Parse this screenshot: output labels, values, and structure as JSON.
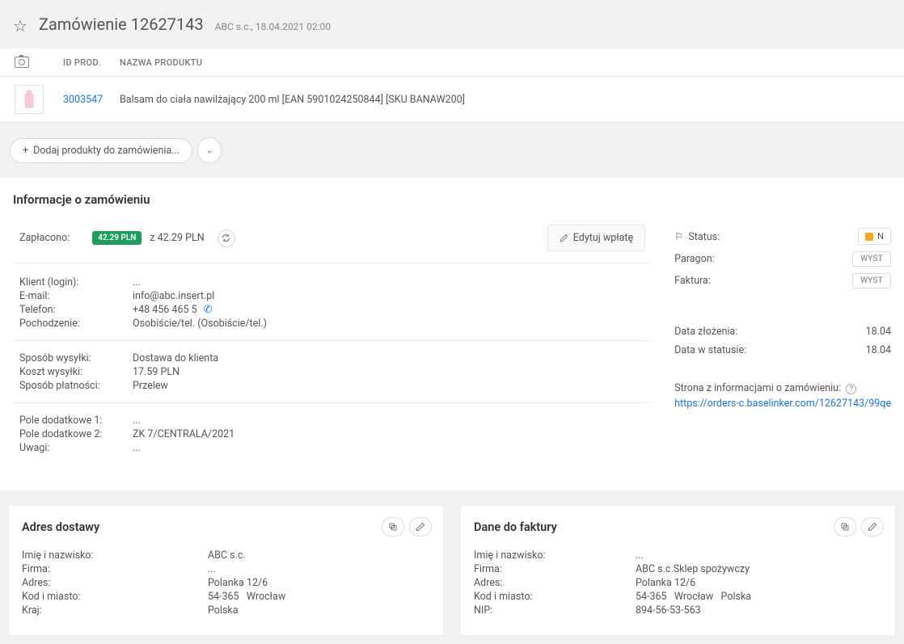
{
  "header": {
    "title": "Zamówienie 12627143",
    "subtitle": "ABC s.c., 18.04.2021 02:00"
  },
  "product_table": {
    "headers": {
      "id": "ID PROD.",
      "name": "NAZWA PRODUKTU"
    },
    "row": {
      "id": "3003547",
      "name": "Balsam do ciała nawilżający 200 ml [EAN 5901024250844] [SKU BANAW200]"
    }
  },
  "actions": {
    "add_products": "Dodaj produkty do zamówienia..."
  },
  "order_info": {
    "title": "Informacje o zamówieniu",
    "paid_label": "Zapłacono:",
    "paid_badge": "42.29 PLN",
    "paid_total": "z 42.29 PLN",
    "edit_payment": "Edytuj wpłatę",
    "client_login_label": "Klient (login):",
    "client_login_value": "...",
    "email_label": "E-mail:",
    "email_value": "info@abc.insert.pl",
    "phone_label": "Telefon:",
    "phone_value": "+48 456 465 5",
    "origin_label": "Pochodzenie:",
    "origin_value": "Osobiście/tel. (Osobiście/tel.)",
    "shipping_method_label": "Sposób wysyłki:",
    "shipping_method_value": "Dostawa do klienta",
    "shipping_cost_label": "Koszt wysyłki:",
    "shipping_cost_value": "17.59 PLN",
    "payment_method_label": "Sposób płatności:",
    "payment_method_value": "Przelew",
    "extra1_label": "Pole dodatkowe 1:",
    "extra1_value": "...",
    "extra2_label": "Pole dodatkowe 2:",
    "extra2_value": "ZK 7/CENTRALA/2021",
    "notes_label": "Uwagi:",
    "notes_value": "..."
  },
  "right_panel": {
    "status_label": "Status:",
    "status_value": "N",
    "receipt_label": "Paragon:",
    "receipt_btn": "WYST",
    "invoice_label": "Faktura:",
    "invoice_btn": "WYST",
    "date_created_label": "Data złożenia:",
    "date_created_value": "18.04",
    "date_status_label": "Data w statusie:",
    "date_status_value": "18.04",
    "info_page_label": "Strona z informacjami o zamówieniu:",
    "info_page_url": "https://orders-c.baselinker.com/12627143/99qe"
  },
  "delivery_address": {
    "title": "Adres dostawy",
    "name_label": "Imię i nazwisko:",
    "name_value": "ABC s.c.",
    "company_label": "Firma:",
    "company_value": "...",
    "address_label": "Adres:",
    "address_value": "Polanka 12/6",
    "zipcity_label": "Kod i miasto:",
    "zip_value": "54-365",
    "city_value": "Wrocław",
    "country_label": "Kraj:",
    "country_value": "Polska"
  },
  "invoice_data": {
    "title": "Dane do faktury",
    "name_label": "Imię i nazwisko:",
    "name_value": "...",
    "company_label": "Firma:",
    "company_value": "ABC s.c.Sklep spożywczy",
    "address_label": "Adres:",
    "address_value": "Polanka 12/6",
    "zipcity_label": "Kod i miasto:",
    "zip_value": "54-365",
    "city_value": "Wrocław",
    "country_value": "Polska",
    "nip_label": "NIP:",
    "nip_value": "894-56-53-563"
  }
}
